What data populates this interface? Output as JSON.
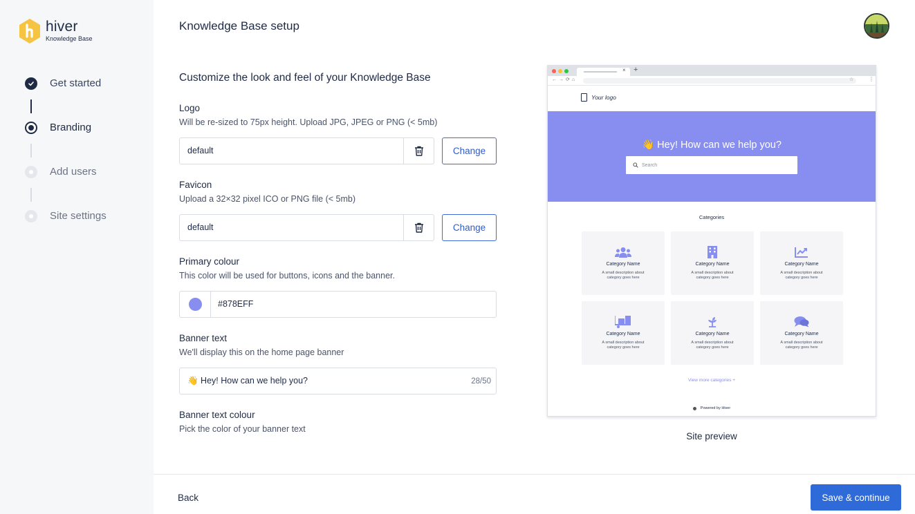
{
  "brand": {
    "name": "hiver",
    "subtitle": "Knowledge Base",
    "color": "#f5c442"
  },
  "steps": [
    {
      "label": "Get started",
      "state": "done"
    },
    {
      "label": "Branding",
      "state": "current"
    },
    {
      "label": "Add users",
      "state": "pending"
    },
    {
      "label": "Site settings",
      "state": "pending"
    }
  ],
  "header": {
    "title": "Knowledge Base setup"
  },
  "form": {
    "heading": "Customize the look and feel of your Knowledge Base",
    "logo": {
      "label": "Logo",
      "hint": "Will be re-sized to 75px height. Upload JPG, JPEG or PNG (< 5mb)",
      "value": "default",
      "change_label": "Change"
    },
    "favicon": {
      "label": "Favicon",
      "hint": "Upload a 32×32 pixel ICO or PNG file (< 5mb)",
      "value": "default",
      "change_label": "Change"
    },
    "primary_colour": {
      "label": "Primary colour",
      "hint": "This color will be used for buttons, icons and the banner.",
      "value": "#878EFF"
    },
    "banner_text": {
      "label": "Banner text",
      "hint": "We'll display this on the home page banner",
      "value": "👋 Hey! How can we help you?",
      "count": "28/50"
    },
    "banner_text_colour": {
      "label": "Banner text colour",
      "hint": "Pick the color of your banner text"
    }
  },
  "preview": {
    "logo_text": "Your logo",
    "banner_text": "👋 Hey! How can we help you?",
    "search_placeholder": "Search",
    "categories_title": "Categories",
    "cards": [
      {
        "icon": "users-icon",
        "name": "Category Name",
        "desc": "A small description about category goes here"
      },
      {
        "icon": "building-icon",
        "name": "Category Name",
        "desc": "A small description about category goes here"
      },
      {
        "icon": "chart-icon",
        "name": "Category Name",
        "desc": "A small description about category goes here"
      },
      {
        "icon": "delivery-icon",
        "name": "Category Name",
        "desc": "A small description about category goes here"
      },
      {
        "icon": "seedling-icon",
        "name": "Category Name",
        "desc": "A small description about category goes here"
      },
      {
        "icon": "chat-icon",
        "name": "Category Name",
        "desc": "A small description about category goes here"
      }
    ],
    "more_link": "View more categories +",
    "powered_by": "Powered by Hiver",
    "caption": "Site preview",
    "accent": "#878eef"
  },
  "footer": {
    "back_label": "Back",
    "save_label": "Save & continue"
  }
}
